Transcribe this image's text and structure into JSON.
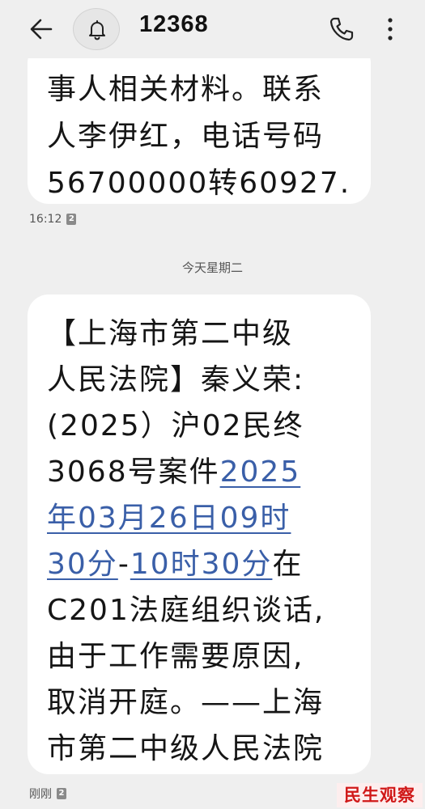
{
  "header": {
    "contact": "12368",
    "back_icon": "arrow-left-icon",
    "notification_icon": "bell-icon",
    "call_icon": "phone-icon",
    "menu_icon": "more-vertical-icon"
  },
  "messages": [
    {
      "lines": [
        "事人相关材料。联系",
        "人李伊红，电话号码",
        "56700000转60927."
      ],
      "time": "16:12",
      "sim": "2"
    },
    {
      "line1": "【上海市第二中级",
      "line2": "人民法院】秦义荣:",
      "line3": "(2025）沪02民终",
      "line4_text": "3068号案件",
      "line4_link": "2025",
      "line5_link": "年03月26日09时",
      "line6_link1": "30分",
      "line6_sep": "-",
      "line6_link2": "10时30分",
      "line6_tail": "在",
      "line7": "C201法庭组织谈话,",
      "line8": "由于工作需要原因,",
      "line9": "取消开庭。——上海",
      "line10": "市第二中级人民法院",
      "time": "刚刚",
      "sim": "2"
    }
  ],
  "day_divider": "今天星期二",
  "watermark": "民生观察",
  "colors": {
    "background": "#efefef",
    "bubble": "#ffffff",
    "link": "#3a5fa8",
    "watermark": "#d01818"
  }
}
